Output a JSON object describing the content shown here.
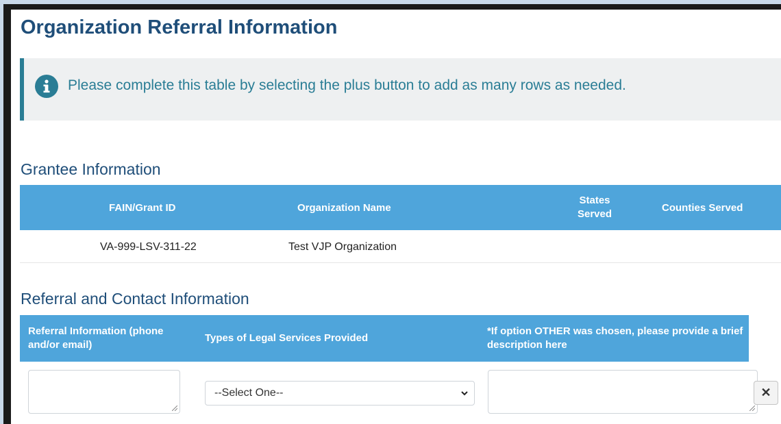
{
  "page": {
    "title": "Organization Referral Information"
  },
  "alert": {
    "icon": "info-icon",
    "text": "Please complete this table by selecting the plus button to add as many rows as needed."
  },
  "grantee": {
    "section_title": "Grantee Information",
    "headers": {
      "fain": "FAIN/Grant ID",
      "org_name": "Organization Name",
      "states": "States Served",
      "counties": "Counties Served"
    },
    "rows": [
      {
        "fain": "VA-999-LSV-311-22",
        "org_name": "Test VJP Organization",
        "states": "",
        "counties": ""
      }
    ]
  },
  "referral": {
    "section_title": "Referral and Contact Information",
    "headers": {
      "referral_info": "Referral Information (phone and/or email)",
      "legal_services": "Types of Legal Services Provided",
      "other_description": "*If option OTHER was chosen, please provide a brief description here"
    },
    "row": {
      "referral_info_value": "",
      "legal_services_selected": "--Select One--",
      "other_description_value": "",
      "remove_label": "✕"
    }
  },
  "colors": {
    "title": "#1f4e79",
    "header_bg": "#4fa5db",
    "alert_accent": "#2a7d95",
    "alert_bg": "#eef0f1"
  }
}
